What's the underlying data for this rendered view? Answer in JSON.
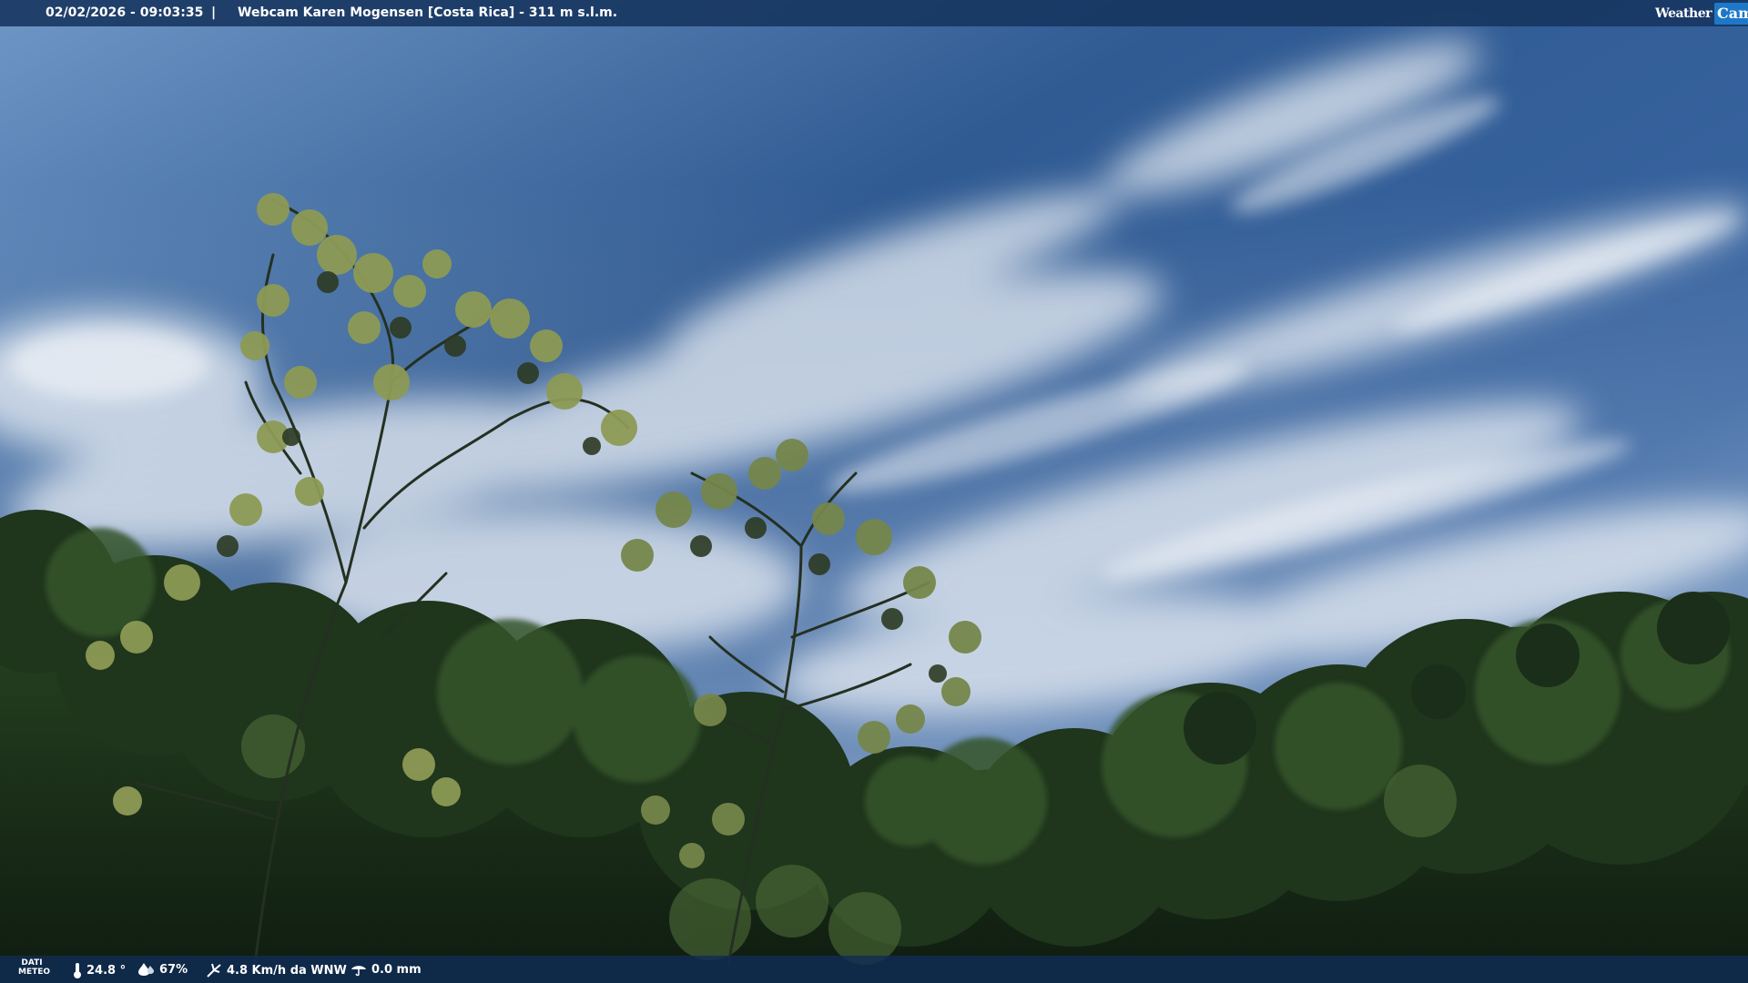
{
  "overlay_top": {
    "datetime": "02/02/2026 - 09:03:35",
    "separator": "|",
    "title": "Webcam Karen Mogensen [Costa Rica]  - 311 m s.l.m.",
    "logo_text_weather": "Weather",
    "logo_text_cam": "Cam"
  },
  "overlay_bottom": {
    "label_line1": "DATI",
    "label_line2": "METEO",
    "temperature": "24.8 °",
    "humidity": "67%",
    "wind": "4.8 Km/h da WNW",
    "rain": "0.0 mm"
  },
  "colors": {
    "sky_top": "#2a4f86",
    "sky_mid": "#4f79b2",
    "cloud": "#e9eef4",
    "foliage_dark": "#16291a",
    "foliage_mid": "#2f4d27",
    "leaf_light": "#8d9a55",
    "bar_bg": "#16345e"
  },
  "icons": {
    "thermometer": "thermometer-icon",
    "humidity": "humidity-icon",
    "wind": "wind-icon",
    "rain": "rain-icon"
  }
}
